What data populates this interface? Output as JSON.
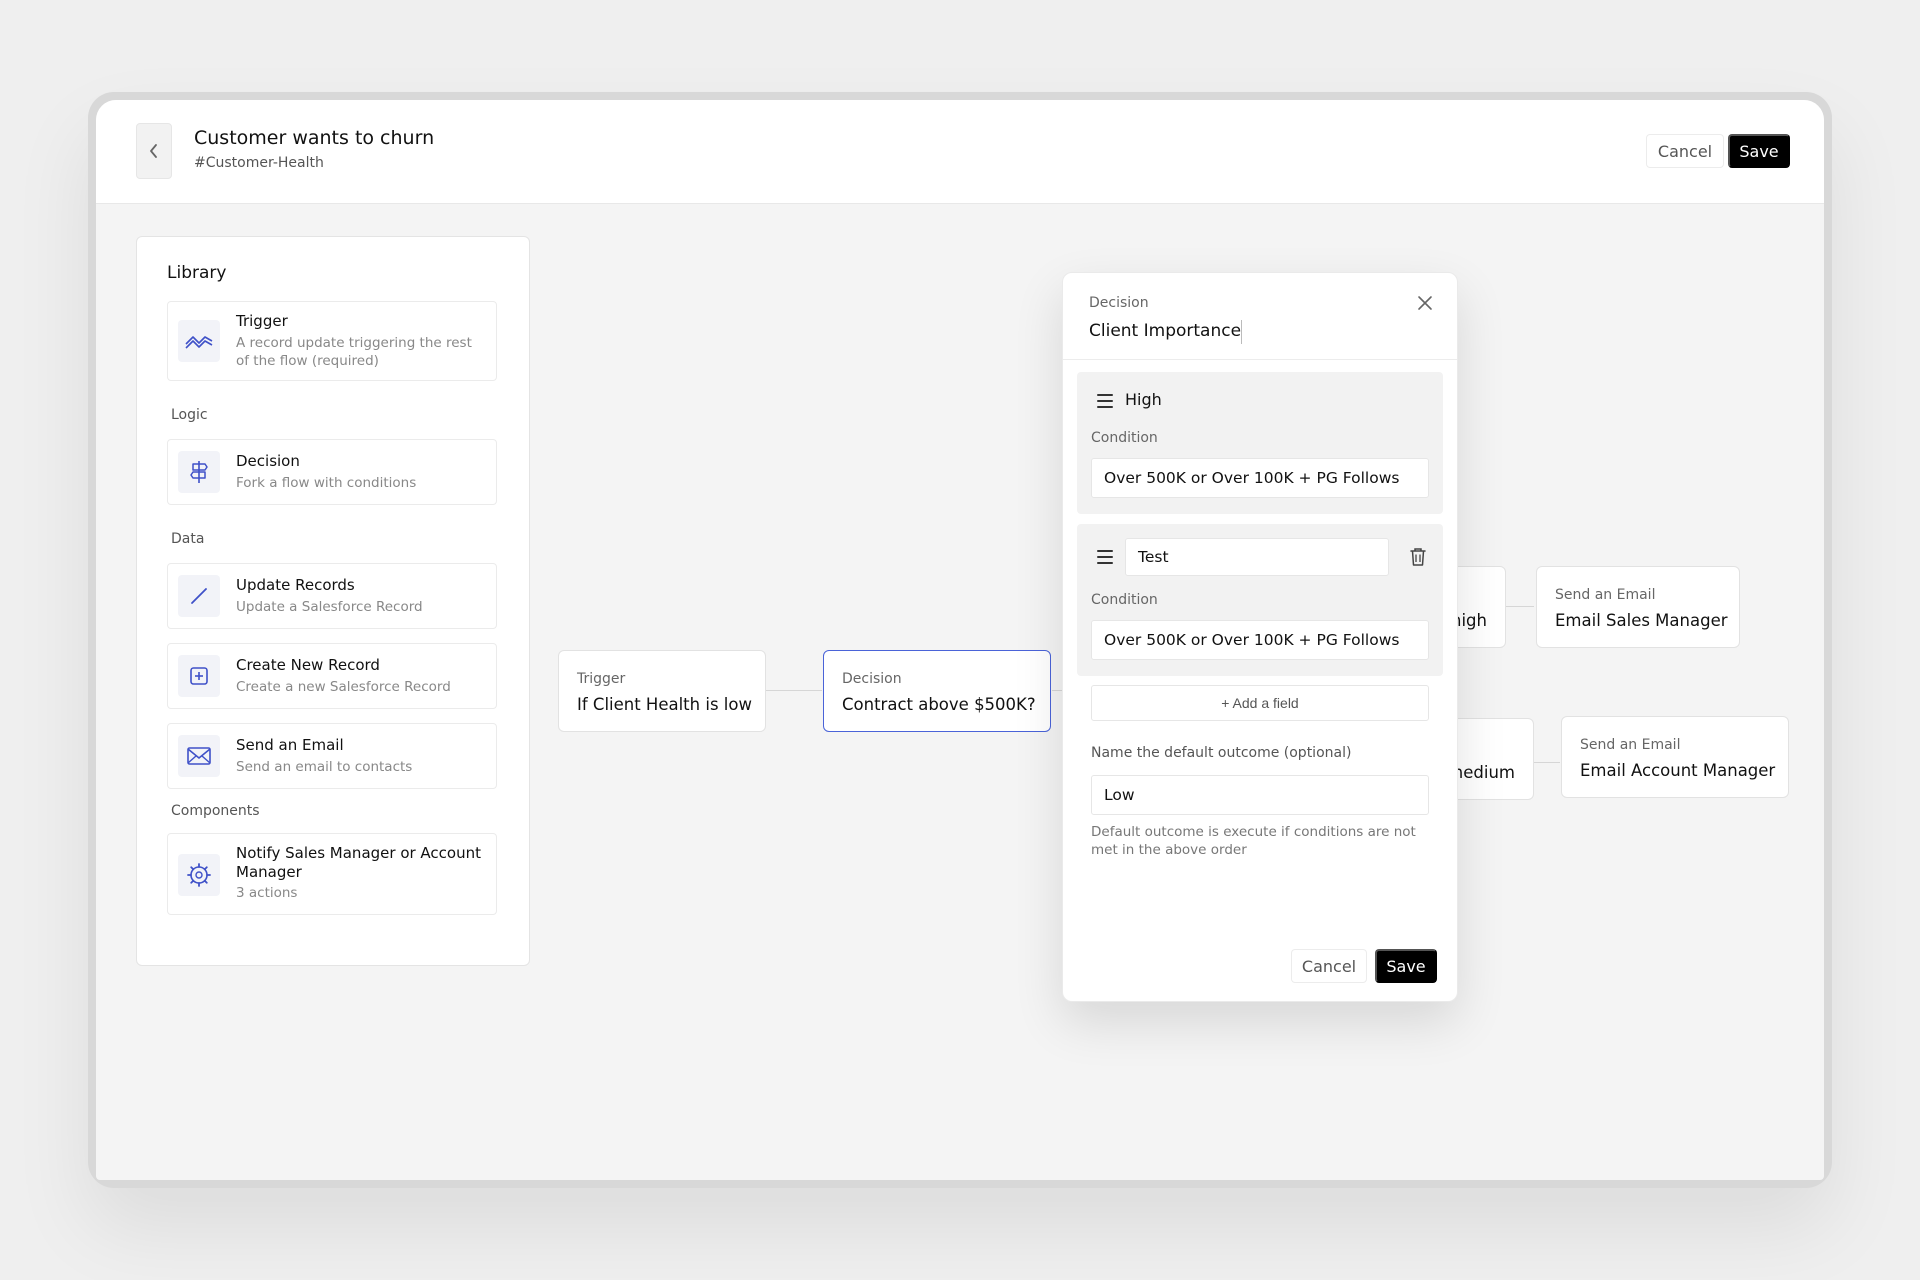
{
  "header": {
    "title": "Customer wants to churn",
    "subtitle": "#Customer-Health",
    "cancel_label": "Cancel",
    "save_label": "Save"
  },
  "library": {
    "title": "Library",
    "trigger": {
      "name": "Trigger",
      "desc": "A record update triggering the rest of the flow (required)",
      "icon": "trend-icon"
    },
    "sections": {
      "logic": "Logic",
      "data": "Data",
      "components": "Components"
    },
    "decision": {
      "name": "Decision",
      "desc": "Fork a flow with conditions",
      "icon": "signpost-icon"
    },
    "update_records": {
      "name": "Update Records",
      "desc": "Update a Salesforce Record",
      "icon": "pencil-icon"
    },
    "create_record": {
      "name": "Create New Record",
      "desc": "Create a new Salesforce Record",
      "icon": "plus-square-icon"
    },
    "send_email": {
      "name": "Send an Email",
      "desc": "Send an email to contacts",
      "icon": "envelope-icon"
    },
    "component": {
      "name": "Notify Sales Manager or Account Manager",
      "desc": "3 actions",
      "icon": "gear-icon"
    }
  },
  "flow": {
    "trigger_node": {
      "type": "Trigger",
      "label": "If Client Health is low"
    },
    "decision_node": {
      "type": "Decision",
      "label": "Contract above $500K?"
    },
    "high_node": {
      "label": "high"
    },
    "medium_node": {
      "label": "medium"
    },
    "email_sales": {
      "type": "Send an Email",
      "label": "Email Sales Manager"
    },
    "email_account": {
      "type": "Send an Email",
      "label": "Email Account Manager"
    }
  },
  "modal": {
    "kicker": "Decision",
    "title": "Client Importance",
    "outcomes": [
      {
        "name": "High",
        "condition_label": "Condition",
        "condition": "Over 500K or Over 100K + PG Follows"
      },
      {
        "name": "Test",
        "condition_label": "Condition",
        "condition": "Over 500K or Over 100K + PG Follows"
      }
    ],
    "add_field_label": "+ Add a field",
    "default_label": "Name the default outcome (optional)",
    "default_value": "Low",
    "help_text": "Default outcome is execute if conditions are not met in the above order",
    "cancel_label": "Cancel",
    "save_label": "Save"
  },
  "colors": {
    "accent": "#3f51c8",
    "selected_border": "#4a63d8"
  }
}
